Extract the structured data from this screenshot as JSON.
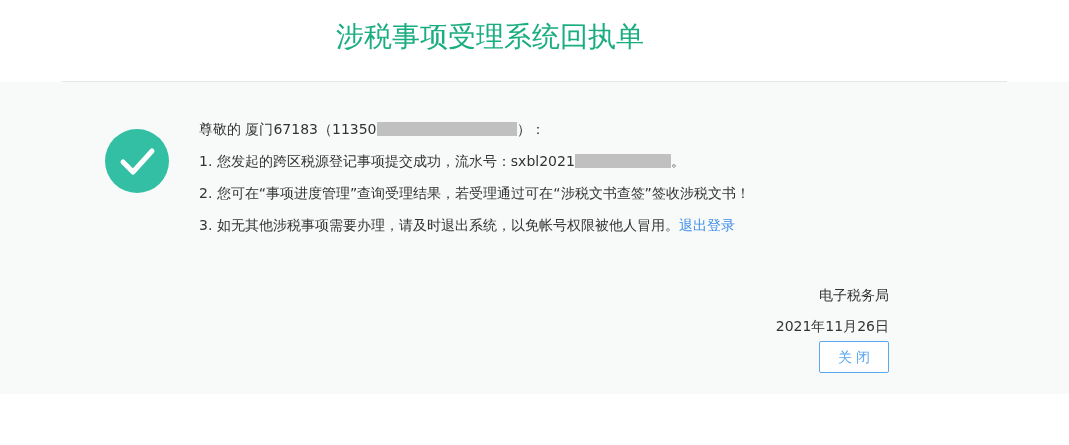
{
  "title": "涉税事项受理系统回执单",
  "greeting": {
    "before": "尊敬的 厦门67183（11350",
    "after": "）："
  },
  "items": [
    {
      "kind": "serial",
      "text": "1. 您发起的跨区税源登记事项提交成功，流水号：sxbl2021",
      "after": "。"
    },
    {
      "kind": "plain",
      "text": "2. 您可在“事项进度管理”查询受理结果，若受理通过可在“涉税文书查签”签收涉税文书！"
    },
    {
      "kind": "link",
      "text": "3. 如无其他涉税事项需要办理，请及时退出系统，以免帐号权限被他人冒用。",
      "link": "退出登录"
    }
  ],
  "issuer": "电子税务局",
  "date": "2021年11月26日",
  "close_button": "关 闭"
}
